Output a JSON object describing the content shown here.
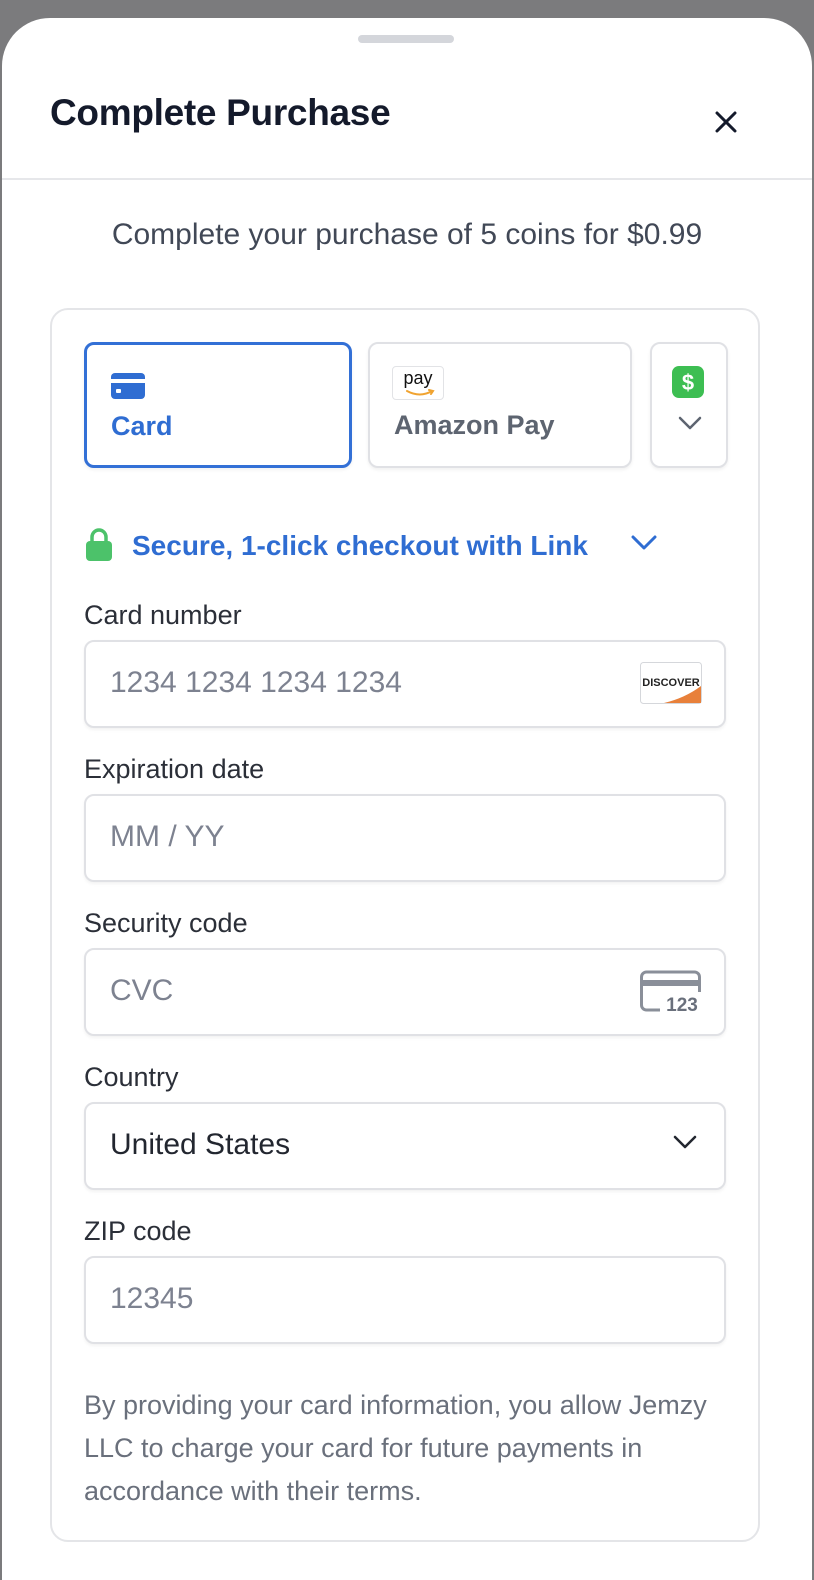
{
  "sheet": {
    "title": "Complete Purchase",
    "subtitle": "Complete your purchase of 5 coins for $0.99"
  },
  "payment_methods": {
    "card_label": "Card",
    "amazon_label": "Amazon Pay",
    "amazon_icon_text": "pay",
    "cash_icon_text": "$"
  },
  "link": {
    "text": "Secure, 1-click checkout with Link"
  },
  "fields": {
    "card_number": {
      "label": "Card number",
      "placeholder": "1234 1234 1234 1234",
      "brand": "DISCOVER"
    },
    "expiration": {
      "label": "Expiration date",
      "placeholder": "MM / YY"
    },
    "security": {
      "label": "Security code",
      "placeholder": "CVC",
      "icon_text": "123"
    },
    "country": {
      "label": "Country",
      "value": "United States"
    },
    "zip": {
      "label": "ZIP code",
      "placeholder": "12345"
    }
  },
  "disclaimer": "By providing your card information, you allow Jemzy LLC to charge your card for future payments in accordance with their terms.",
  "colors": {
    "accent": "#2f6dd2",
    "lock_green": "#4cc26a",
    "cash_green": "#3dbe52"
  },
  "icons": [
    "close-icon",
    "credit-card-icon",
    "amazon-pay-icon",
    "cash-app-icon",
    "chevron-down-icon",
    "lock-icon",
    "discover-logo-icon",
    "cvc-card-icon"
  ]
}
